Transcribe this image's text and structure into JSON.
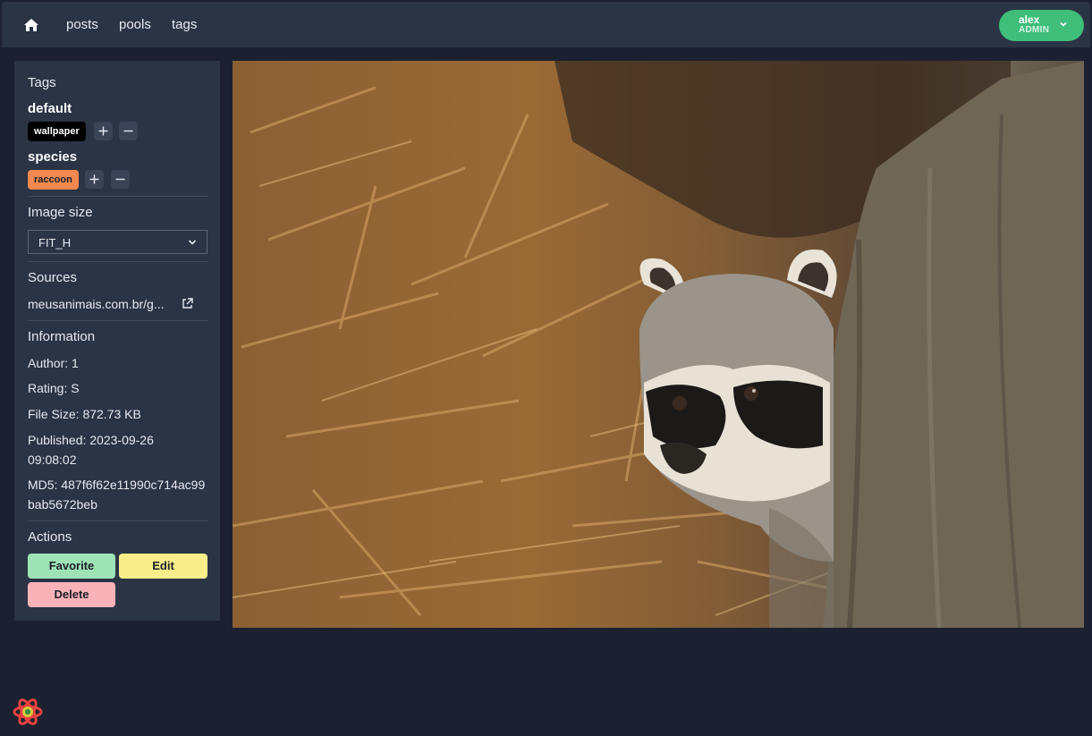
{
  "nav": {
    "home_icon": "home-icon",
    "links": [
      "posts",
      "pools",
      "tags"
    ]
  },
  "user": {
    "name": "alex",
    "role": "ADMIN",
    "menu_icon": "chevron-down-icon"
  },
  "sidebar": {
    "tags_title": "Tags",
    "groups": [
      {
        "name": "default",
        "tags": [
          {
            "label": "wallpaper",
            "color": "#000000"
          }
        ]
      },
      {
        "name": "species",
        "tags": [
          {
            "label": "raccoon",
            "color": "#f0884f"
          }
        ]
      }
    ],
    "image_size_title": "Image size",
    "image_size_value": "FIT_H",
    "sources_title": "Sources",
    "source_link": "meusanimais.com.br/g...",
    "information_title": "Information",
    "author": "Author: 1",
    "rating": "Rating: S",
    "file_size": "File Size: 872.73 KB",
    "published": "Published: 2023-09-26 09:08:02",
    "md5": "MD5: 487f6f62e11990c714ac99bab5672beb",
    "actions_title": "Actions",
    "actions": {
      "favorite": "Favorite",
      "edit": "Edit",
      "delete": "Delete"
    }
  },
  "colors": {
    "background": "#1b2130",
    "panel": "#2b3445",
    "accent_green": "#3fbe7a",
    "favorite": "#9ee3b5",
    "edit": "#f7ee8a",
    "delete": "#f9b3b8"
  }
}
